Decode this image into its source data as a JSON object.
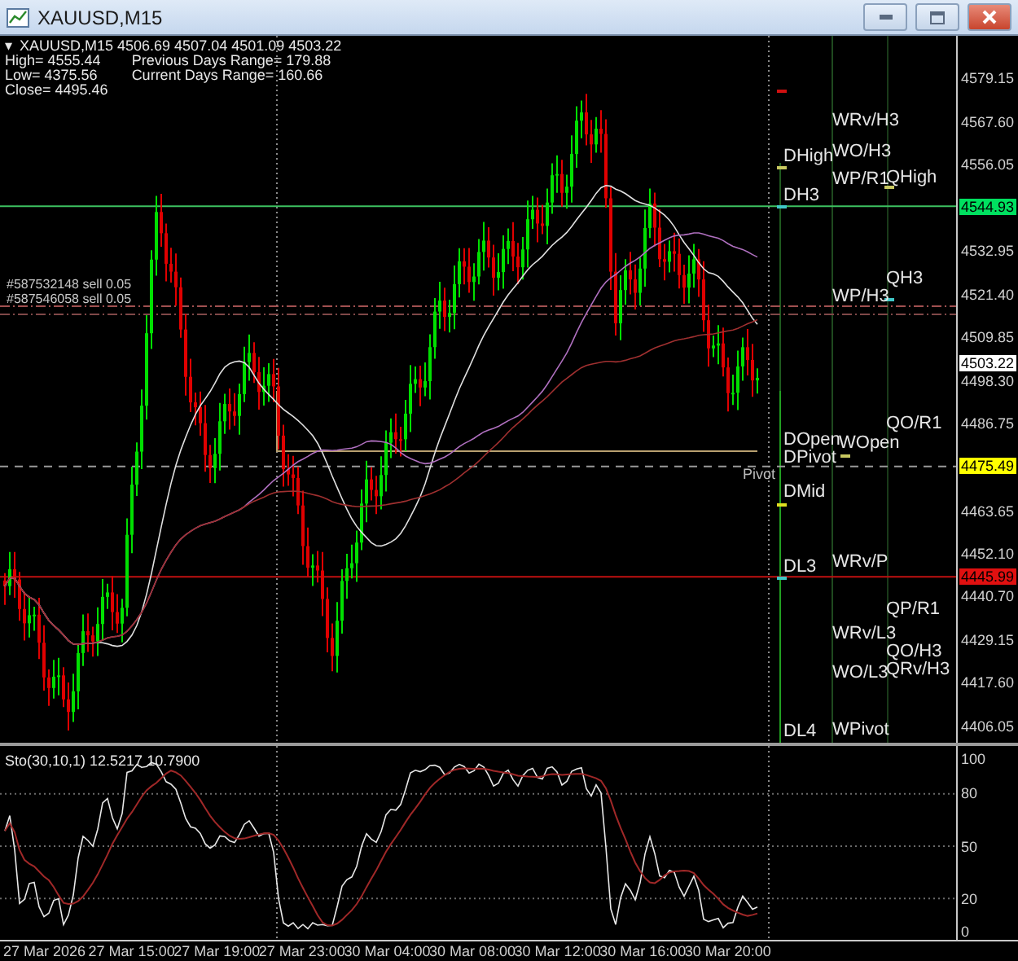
{
  "window": {
    "title": "XAUUSD,M15"
  },
  "info": {
    "marker": "▾",
    "quote": "XAUUSD,M15  4506.69 4507.04 4501.09 4503.22",
    "stats": [
      "High= 4555.44",
      "Low= 4375.56",
      "Close= 4495.46"
    ],
    "ranges": [
      "Previous Days Range= 179.88",
      "Current Days Range= 160.66"
    ]
  },
  "orders": [
    "#587532148 sell 0.05",
    "#587546058 sell 0.05"
  ],
  "levels": [
    {
      "label": "WRv/H3",
      "kind": "level"
    },
    {
      "label": "DHigh",
      "kind": "level"
    },
    {
      "label": "WO/H3",
      "kind": "level"
    },
    {
      "label": "WP/R1",
      "kind": "level"
    },
    {
      "label": "QHigh",
      "kind": "level"
    },
    {
      "label": "DH3",
      "kind": "level"
    },
    {
      "label": "QH3",
      "kind": "level"
    },
    {
      "label": "WP/H3",
      "kind": "level"
    },
    {
      "label": "QO/R1",
      "kind": "level"
    },
    {
      "label": "DOpen",
      "kind": "level"
    },
    {
      "label": "WOpen",
      "kind": "level"
    },
    {
      "label": "DPivot",
      "kind": "level"
    },
    {
      "label": "Pivot",
      "kind": "note"
    },
    {
      "label": "DMid",
      "kind": "level"
    },
    {
      "label": "WRv/P",
      "kind": "level"
    },
    {
      "label": "DL3",
      "kind": "level"
    },
    {
      "label": "QP/R1",
      "kind": "level"
    },
    {
      "label": "WRv/L3",
      "kind": "level"
    },
    {
      "label": "QO/H3",
      "kind": "level"
    },
    {
      "label": "QRv/H3",
      "kind": "level"
    },
    {
      "label": "WO/L3",
      "kind": "level"
    },
    {
      "label": "WPivot",
      "kind": "level"
    },
    {
      "label": "DL4",
      "kind": "level"
    }
  ],
  "price_axis": [
    {
      "label": "4579.15",
      "kind": "tick"
    },
    {
      "label": "4567.60",
      "kind": "tick"
    },
    {
      "label": "4556.05",
      "kind": "tick"
    },
    {
      "label": "4544.93",
      "kind": "marker",
      "color": "#00e060"
    },
    {
      "label": "4532.95",
      "kind": "tick"
    },
    {
      "label": "4521.40",
      "kind": "tick"
    },
    {
      "label": "4509.85",
      "kind": "tick"
    },
    {
      "label": "4503.22",
      "kind": "marker",
      "color": "#ffffff"
    },
    {
      "label": "4498.30",
      "kind": "tick"
    },
    {
      "label": "4486.75",
      "kind": "tick"
    },
    {
      "label": "4475.49",
      "kind": "marker",
      "color": "#ffff00"
    },
    {
      "label": "4463.65",
      "kind": "tick"
    },
    {
      "label": "4452.10",
      "kind": "tick"
    },
    {
      "label": "4445.99",
      "kind": "marker",
      "color": "#e01010"
    },
    {
      "label": "4440.70",
      "kind": "tick"
    },
    {
      "label": "4429.15",
      "kind": "tick"
    },
    {
      "label": "4417.60",
      "kind": "tick"
    },
    {
      "label": "4406.05",
      "kind": "tick"
    }
  ],
  "oscillator": {
    "title": "Sto(30,10,1) 12.5217 10.7900",
    "axis": [
      "100",
      "80",
      "50",
      "20",
      "0"
    ]
  },
  "time_axis": [
    "27 Mar 2026",
    "27 Mar 15:00",
    "27 Mar 19:00",
    "27 Mar 23:00",
    "30 Mar 04:00",
    "30 Mar 08:00",
    "30 Mar 12:00",
    "30 Mar 16:00",
    "30 Mar 20:00"
  ]
}
